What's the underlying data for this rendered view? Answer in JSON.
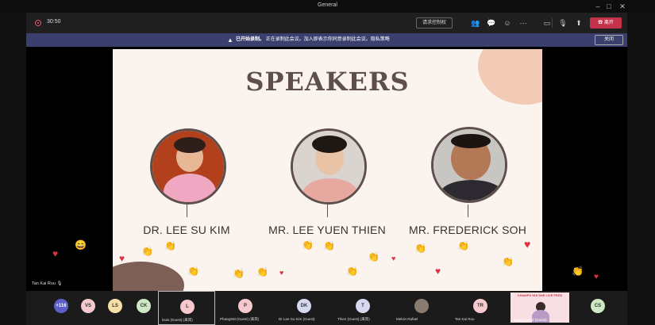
{
  "window": {
    "title": "General"
  },
  "toolbar": {
    "timer": "30:50",
    "control_label": "请求控制权",
    "leave_label": "离开"
  },
  "banner": {
    "warn_glyph": "▲",
    "bold_text": "已开始录制。",
    "message": "正在录制此会议。加入即表示你同意录制此会议。隐私策略",
    "close_label": "关闭"
  },
  "slide": {
    "title": "SPEAKERS",
    "speakers": [
      {
        "name": "DR. LEE SU KIM"
      },
      {
        "name": "MR. LEE YUEN THIEN"
      },
      {
        "name": "MR. FREDERICK SOH"
      }
    ]
  },
  "host_label": "Tan Kai Rou",
  "participants": [
    {
      "initials": "+116",
      "label": "",
      "color": "#5b5fc7"
    },
    {
      "initials": "VS",
      "label": "",
      "color": "#f6c9cf"
    },
    {
      "initials": "LS",
      "label": "",
      "color": "#f7e0a8"
    },
    {
      "initials": "CK",
      "label": "",
      "color": "#cde8c4"
    },
    {
      "initials": "L",
      "label": "louis (Guest) (来宾)",
      "color": "#f6c9cf"
    },
    {
      "initials": "P",
      "label": "PhangSM (Guest) (来宾)",
      "color": "#f6c9cf"
    },
    {
      "initials": "DK",
      "label": "Dr Lee Su Kim (Guest)",
      "color": "#d6d9f0"
    },
    {
      "initials": "T",
      "label": "Thien (Guest) (来宾)",
      "color": "#d6d9f0"
    },
    {
      "initials": "",
      "label": "Melvin Rafael",
      "color": "#8a7b6f"
    },
    {
      "initials": "TR",
      "label": "Tan Kai Rou",
      "color": "#f6c9cf"
    },
    {
      "initials": "",
      "label": "Hartini Yusof (Guest)",
      "color": "#f8dfe3"
    },
    {
      "initials": "CS",
      "label": "",
      "color": "#cde8c4"
    }
  ],
  "video_tile_text": "CHAMPS HUI SHE LIVE FEED",
  "colors": {
    "leave": "#c4314b",
    "banner": "#3b3f6e",
    "accent": "#5b5fc7"
  }
}
